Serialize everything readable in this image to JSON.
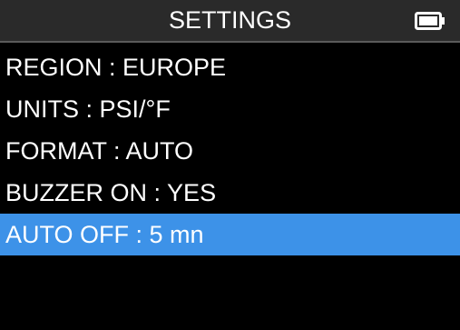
{
  "header": {
    "title": "SETTINGS",
    "battery_icon": "battery-full-icon"
  },
  "menu": {
    "items": [
      {
        "label": "REGION",
        "separator": " : ",
        "value": "EUROPE",
        "selected": false
      },
      {
        "label": "UNITS",
        "separator": " : ",
        "value": "PSI/°F",
        "selected": false
      },
      {
        "label": "FORMAT",
        "separator": " : ",
        "value": "AUTO",
        "selected": false
      },
      {
        "label": "BUZZER ON",
        "separator": " : ",
        "value": "YES",
        "selected": false
      },
      {
        "label": "AUTO OFF",
        "separator": " : ",
        "value": "5 mn",
        "selected": true
      }
    ]
  },
  "colors": {
    "background": "#000000",
    "header_background": "#2a2a2a",
    "selection": "#3d92e8",
    "text": "#ffffff"
  }
}
